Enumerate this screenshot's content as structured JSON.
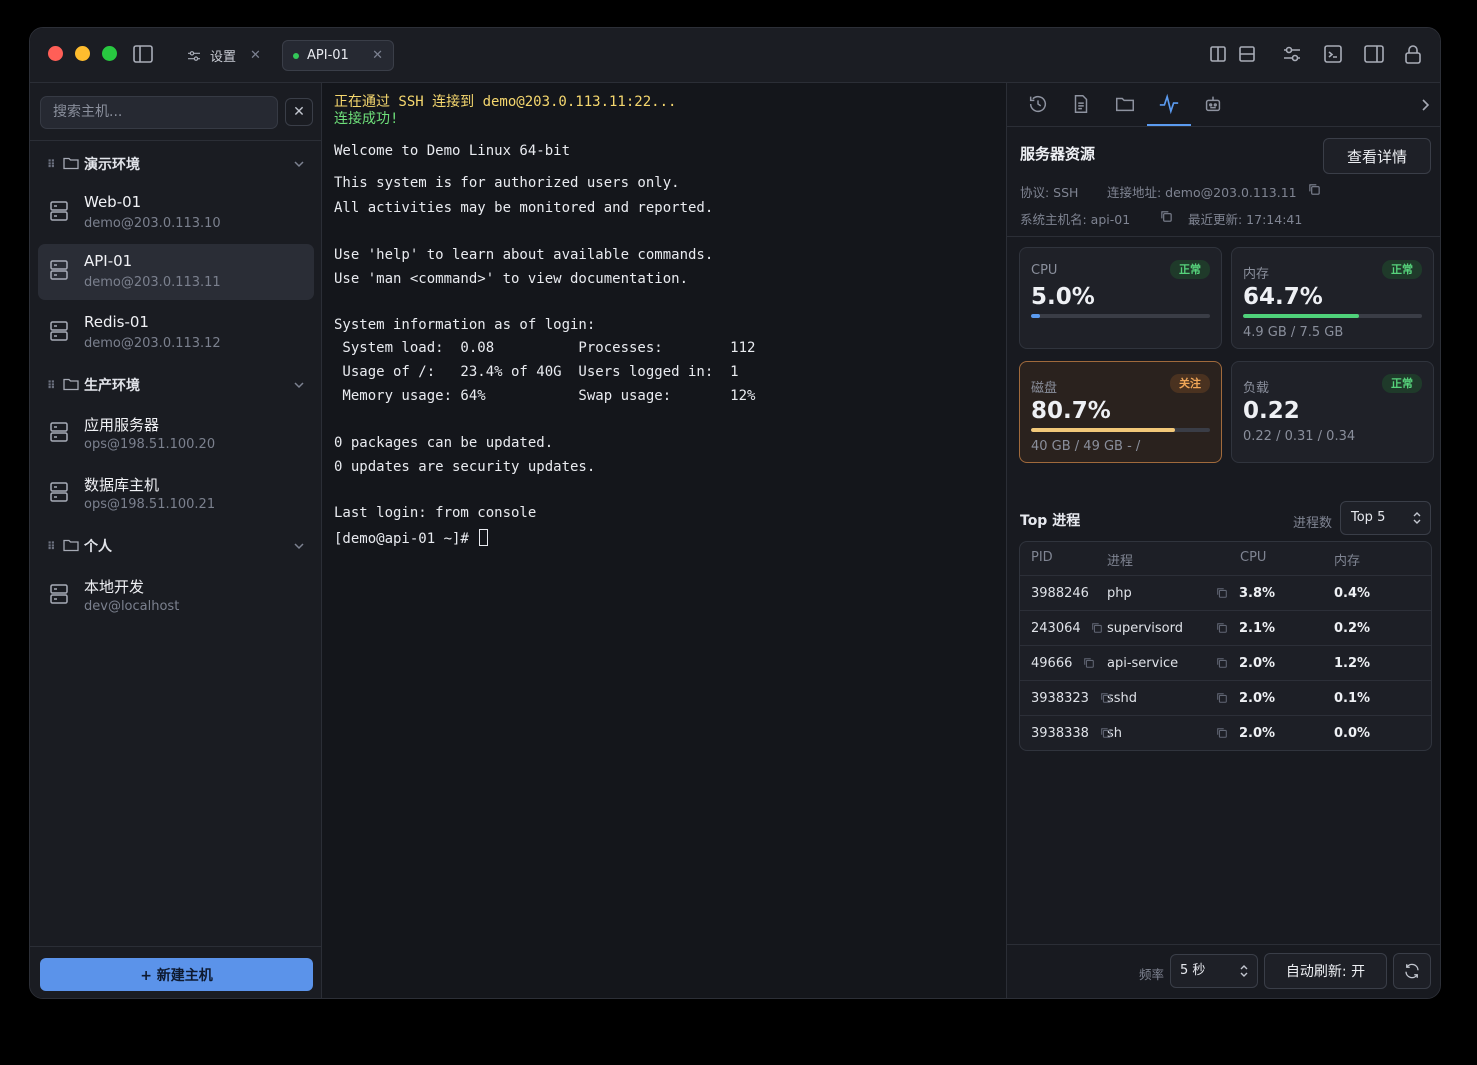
{
  "tabs": {
    "settings_label": "设置",
    "active_label": "API-01"
  },
  "sidebar": {
    "search_placeholder": "搜索主机...",
    "groups": [
      {
        "name": "演示环境",
        "hosts": [
          {
            "name": "Web-01",
            "addr": "demo@203.0.113.10"
          },
          {
            "name": "API-01",
            "addr": "demo@203.0.113.11"
          },
          {
            "name": "Redis-01",
            "addr": "demo@203.0.113.12"
          }
        ]
      },
      {
        "name": "生产环境",
        "hosts": [
          {
            "name": "应用服务器",
            "addr": "ops@198.51.100.20"
          },
          {
            "name": "数据库主机",
            "addr": "ops@198.51.100.21"
          }
        ]
      },
      {
        "name": "个人",
        "hosts": [
          {
            "name": "本地开发",
            "addr": "dev@localhost"
          }
        ]
      }
    ],
    "new_host_label": "+ 新建主机"
  },
  "terminal": {
    "lines": [
      "正在通过 SSH 连接到 demo@203.0.113.11:22...",
      "连接成功!",
      "Welcome to Demo Linux 64-bit",
      "This system is for authorized users only.",
      "All activities may be monitored and reported.",
      "Use 'help' to learn about available commands.",
      "Use 'man <command>' to view documentation.",
      "System information as of login:",
      " System load:  0.08          Processes:        112",
      " Usage of /:   23.4% of 40G  Users logged in:  1",
      " Memory usage: 64%           Swap usage:       12%",
      "0 packages can be updated.",
      "0 updates are security updates.",
      "Last login: from console",
      "[demo@api-01 ~]# "
    ]
  },
  "panel": {
    "title": "服务器资源",
    "detail_button": "查看详情",
    "protocol": "协议: SSH",
    "address": "连接地址: demo@203.0.113.11",
    "hostname": "系统主机名: api-01",
    "updated": "最近更新: 17:14:41",
    "cards": [
      {
        "label": "CPU",
        "badge": "正常",
        "value": "5.0%",
        "percent": 5.0,
        "sub": "",
        "color": "#5b9bf0"
      },
      {
        "label": "内存",
        "badge": "正常",
        "value": "64.7%",
        "percent": 64.7,
        "sub": "4.9 GB / 7.5 GB",
        "color": "#4fd17a"
      },
      {
        "label": "磁盘",
        "badge": "关注",
        "value": "80.7%",
        "percent": 80.7,
        "sub": "40 GB / 49 GB - /",
        "color": "#f2c879"
      },
      {
        "label": "负载",
        "badge": "正常",
        "value": "0.22",
        "percent": null,
        "sub": "0.22 / 0.31 / 0.34",
        "color": ""
      }
    ],
    "top_title": "Top 进程",
    "top_count_label": "进程数",
    "top_count_value": "Top 5",
    "table": {
      "headers": [
        "PID",
        "进程",
        "CPU",
        "内存"
      ],
      "rows": [
        {
          "pid": "3988246",
          "name": "php",
          "cpu": "3.8%",
          "mem": "0.4%"
        },
        {
          "pid": "243064",
          "name": "supervisord",
          "cpu": "2.1%",
          "mem": "0.2%"
        },
        {
          "pid": "49666",
          "name": "api-service",
          "cpu": "2.0%",
          "mem": "1.2%"
        },
        {
          "pid": "3938323",
          "name": "sshd",
          "cpu": "2.0%",
          "mem": "0.1%"
        },
        {
          "pid": "3938338",
          "name": "sh",
          "cpu": "2.0%",
          "mem": "0.0%"
        }
      ]
    },
    "freq_label": "频率",
    "freq_value": "5 秒",
    "auto_refresh": "自动刷新: 开"
  }
}
